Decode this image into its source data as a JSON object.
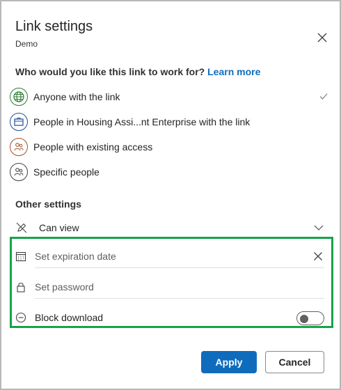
{
  "dialog": {
    "title": "Link settings",
    "subtitle": "Demo"
  },
  "audience": {
    "question": "Who would you like this link to work for?",
    "learn_more": "Learn more",
    "options": [
      {
        "label": "Anyone with the link",
        "icon": "globe-icon",
        "selected": true
      },
      {
        "label": "People in Housing Assi...nt Enterprise with the link",
        "icon": "building-icon",
        "selected": false
      },
      {
        "label": "People with existing access",
        "icon": "people-icon",
        "selected": false
      },
      {
        "label": "Specific people",
        "icon": "people-icon",
        "selected": false
      }
    ]
  },
  "other_settings": {
    "heading": "Other settings",
    "permission": {
      "label": "Can view",
      "icon": "pencil-slash-icon"
    },
    "expiration": {
      "placeholder": "Set expiration date",
      "icon": "calendar-icon"
    },
    "password": {
      "placeholder": "Set password",
      "icon": "lock-icon"
    },
    "block_download": {
      "label": "Block download",
      "icon": "block-icon",
      "enabled": false
    }
  },
  "buttons": {
    "apply": "Apply",
    "cancel": "Cancel"
  },
  "colors": {
    "accent": "#0f6cbd",
    "highlight": "#16a34a"
  }
}
